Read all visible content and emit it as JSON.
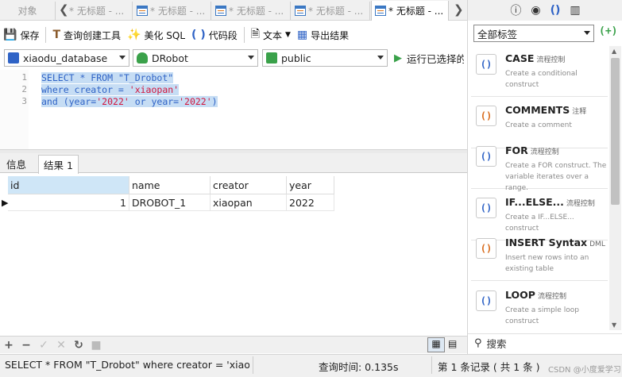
{
  "tabs": {
    "objects_label": "对象",
    "query_tabs": [
      {
        "label": "* 无标题 - ..."
      },
      {
        "label": "* 无标题 - ..."
      },
      {
        "label": "* 无标题 - ..."
      },
      {
        "label": "* 无标题 - ..."
      },
      {
        "label": "* 无标题 - ...",
        "active": true
      }
    ]
  },
  "toolbar": {
    "save": "保存",
    "query_builder": "查询创建工具",
    "beautify": "美化 SQL",
    "code_snippet": "代码段",
    "text": "文本",
    "export": "导出结果"
  },
  "selectors": {
    "connection": "xiaodu_database",
    "database": "DRobot",
    "schema": "public",
    "run_selected": "运行已选择的"
  },
  "editor": {
    "lines": [
      {
        "n": "1",
        "text": "SELECT * FROM \"T_Drobot\""
      },
      {
        "n": "2",
        "pre": "where creator = ",
        "str": "'xiaopan'"
      },
      {
        "n": "3",
        "pre": "and (year=",
        "str1": "'2022'",
        "mid": " or year=",
        "str2": "'2022'",
        "post": ")"
      }
    ]
  },
  "result_tabs": [
    "信息",
    "结果 1"
  ],
  "grid": {
    "columns": [
      "id",
      "name",
      "creator",
      "year"
    ],
    "rows": [
      {
        "id": "1",
        "name": "DROBOT_1",
        "creator": "xiaopan",
        "year": "2022"
      }
    ]
  },
  "status": {
    "sql": "SELECT * FROM \"T_Drobot\" where creator = 'xiaopan'",
    "query_time": "查询时间: 0.135s",
    "record": "第 1 条记录 ( 共 1 条 )",
    "watermark": "CSDN @小度爱学习"
  },
  "right_panel": {
    "tag_select": "全部标签",
    "search": "搜索",
    "snippets": [
      {
        "title": "CASE",
        "tag": "流程控制",
        "desc": "Create a conditional construct"
      },
      {
        "title": "COMMENTS",
        "tag": "注释",
        "desc": "Create a comment"
      },
      {
        "title": "FOR",
        "tag": "流程控制",
        "desc": "Create a FOR construct. The variable iterates over a range."
      },
      {
        "title": "IF...ELSE...",
        "tag": "流程控制",
        "desc": "Create a IF...ELSE... construct"
      },
      {
        "title": "INSERT Syntax",
        "tag": "DML",
        "desc": "Insert new rows into an existing table"
      },
      {
        "title": "LOOP",
        "tag": "流程控制",
        "desc": "Create a simple loop construct"
      }
    ]
  },
  "colors": {
    "accent": "#2f63c6",
    "string": "#d2143b",
    "selection": "#c6ddf4",
    "run_green": "#3aa14a"
  }
}
